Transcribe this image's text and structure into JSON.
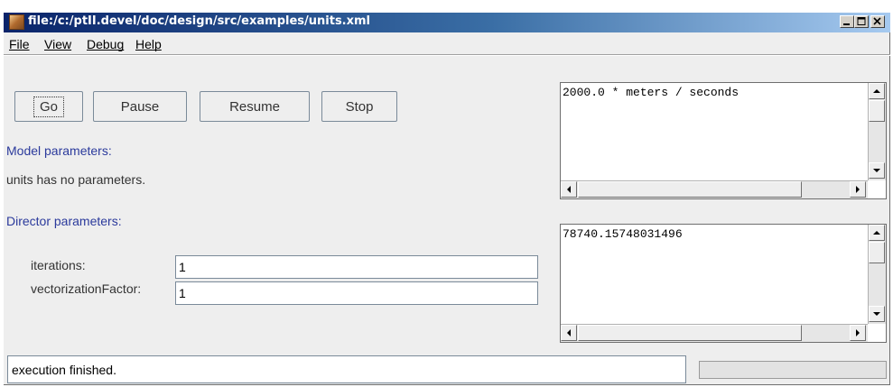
{
  "window": {
    "title": "file:/c:/ptII.devel/doc/design/src/examples/units.xml",
    "icon": "ptolemy-app-icon",
    "controls": [
      "minimize-icon",
      "maximize-icon",
      "close-icon"
    ]
  },
  "menu": [
    "File",
    "View",
    "Debug",
    "Help"
  ],
  "buttons": {
    "go": "Go",
    "pause": "Pause",
    "resume": "Resume",
    "stop": "Stop"
  },
  "model": {
    "heading": "Model parameters:",
    "note": "units has no parameters."
  },
  "director": {
    "heading": "Director parameters:",
    "params": [
      {
        "label": "iterations:",
        "value": "1"
      },
      {
        "label": "vectorizationFactor:",
        "value": "1"
      }
    ]
  },
  "displays": [
    {
      "text": "2000.0 * meters / seconds"
    },
    {
      "text": "78740.15748031496"
    }
  ],
  "status": {
    "text": "execution finished.",
    "progress": 0
  }
}
